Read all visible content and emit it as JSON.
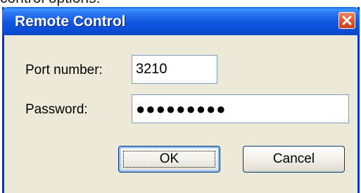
{
  "background_text": "control options.",
  "dialog": {
    "title": "Remote Control",
    "close_icon": "close-icon",
    "port": {
      "label": "Port number:",
      "value": "3210"
    },
    "password": {
      "label": "Password:",
      "masked_value": "●●●●●●●●●"
    },
    "buttons": {
      "ok": "OK",
      "cancel": "Cancel"
    }
  },
  "colors": {
    "titlebar": "#0b4fd6",
    "dialog_background": "#ece9d8",
    "close_button": "#e2552f"
  }
}
